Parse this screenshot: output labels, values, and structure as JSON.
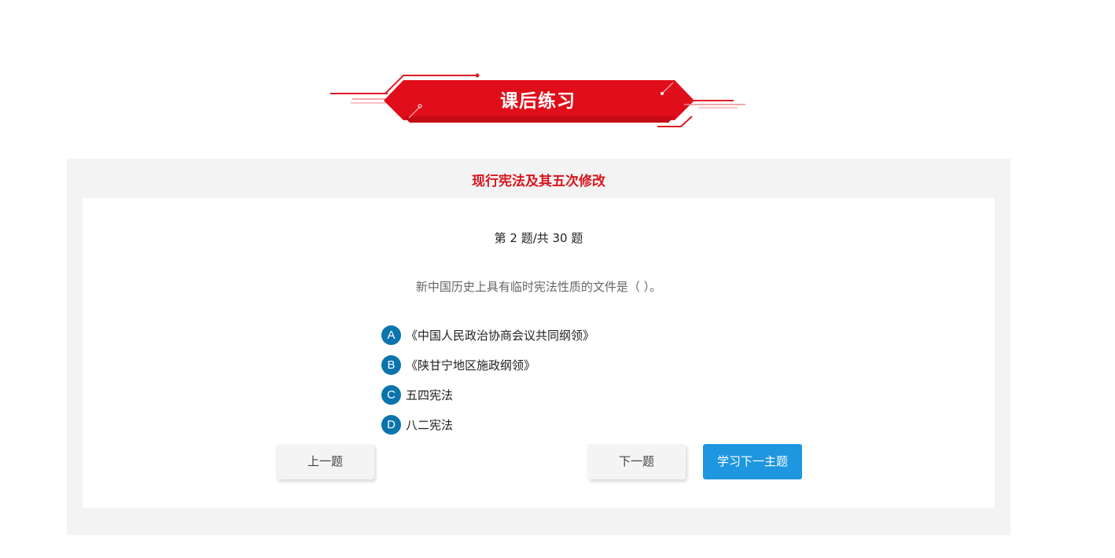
{
  "banner": {
    "title": "课后练习"
  },
  "panel": {
    "title": "现行宪法及其五次修改"
  },
  "quiz": {
    "progress": "第 2 题/共 30 题",
    "question": "新中国历史上具有临时宪法性质的文件是（ ）。",
    "options": [
      {
        "letter": "A",
        "text": "《中国人民政治协商会议共同纲领》"
      },
      {
        "letter": "B",
        "text": "《陕甘宁地区施政纲领》"
      },
      {
        "letter": "C",
        "text": "五四宪法"
      },
      {
        "letter": "D",
        "text": "八二宪法"
      }
    ]
  },
  "buttons": {
    "prev": "上一题",
    "next": "下一题",
    "next_topic": "学习下一主题"
  },
  "colors": {
    "accent_red": "#d7161e",
    "option_blue": "#0a74ad",
    "button_blue": "#1e96e0",
    "panel_bg": "#f3f3f3"
  }
}
